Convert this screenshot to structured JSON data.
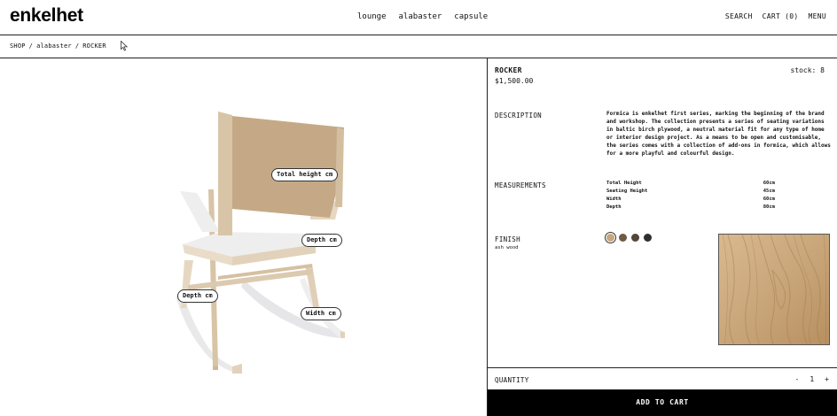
{
  "brand": {
    "logo": "enkelhet"
  },
  "nav": {
    "items": [
      "lounge",
      "alabaster",
      "capsule"
    ]
  },
  "header_actions": {
    "search": "SEARCH",
    "cart": "CART (0)",
    "menu": "MENU"
  },
  "breadcrumb": {
    "shop": "SHOP",
    "sep": "/",
    "collection": "alabaster",
    "product": "ROCKER"
  },
  "viewer": {
    "tags": {
      "total_height": "Total height cm",
      "depth_right": "Depth cm",
      "depth_left": "Depth cm",
      "width": "Width cm"
    }
  },
  "product": {
    "name": "ROCKER",
    "price": "$1,500.00",
    "stock": "stock: 8",
    "description_label": "DESCRIPTION",
    "description": "Formica is enkelhet first series, marking the beginning of the brand and workshop. The collection presents a series of seating variations in baltic birch plywood, a neutral material fit for any type of home or interior design project. As a means to be open and customisable, the series comes with a collection of add-ons in formica, which allows for a more playful and colourful design.",
    "measurements_label": "MEASUREMENTS",
    "measurements": [
      {
        "name": "Total Height",
        "value": "60cm"
      },
      {
        "name": "Seating Height",
        "value": "45cm"
      },
      {
        "name": "Width",
        "value": "60cm"
      },
      {
        "name": "Depth",
        "value": "80cm"
      }
    ],
    "finish_label": "FINISH",
    "finish_selected": "ash wood",
    "finish_swatches": [
      "#c9a77e",
      "#6e5a45",
      "#54463a",
      "#2f2f2f"
    ]
  },
  "purchase": {
    "quantity_label": "QUANTITY",
    "minus": "-",
    "quantity": "1",
    "plus": "+",
    "add_to_cart": "ADD TO CART"
  },
  "colors": {
    "accent": "#000000",
    "wood": "#c8ad8a",
    "chair_back": "#c5a987"
  }
}
